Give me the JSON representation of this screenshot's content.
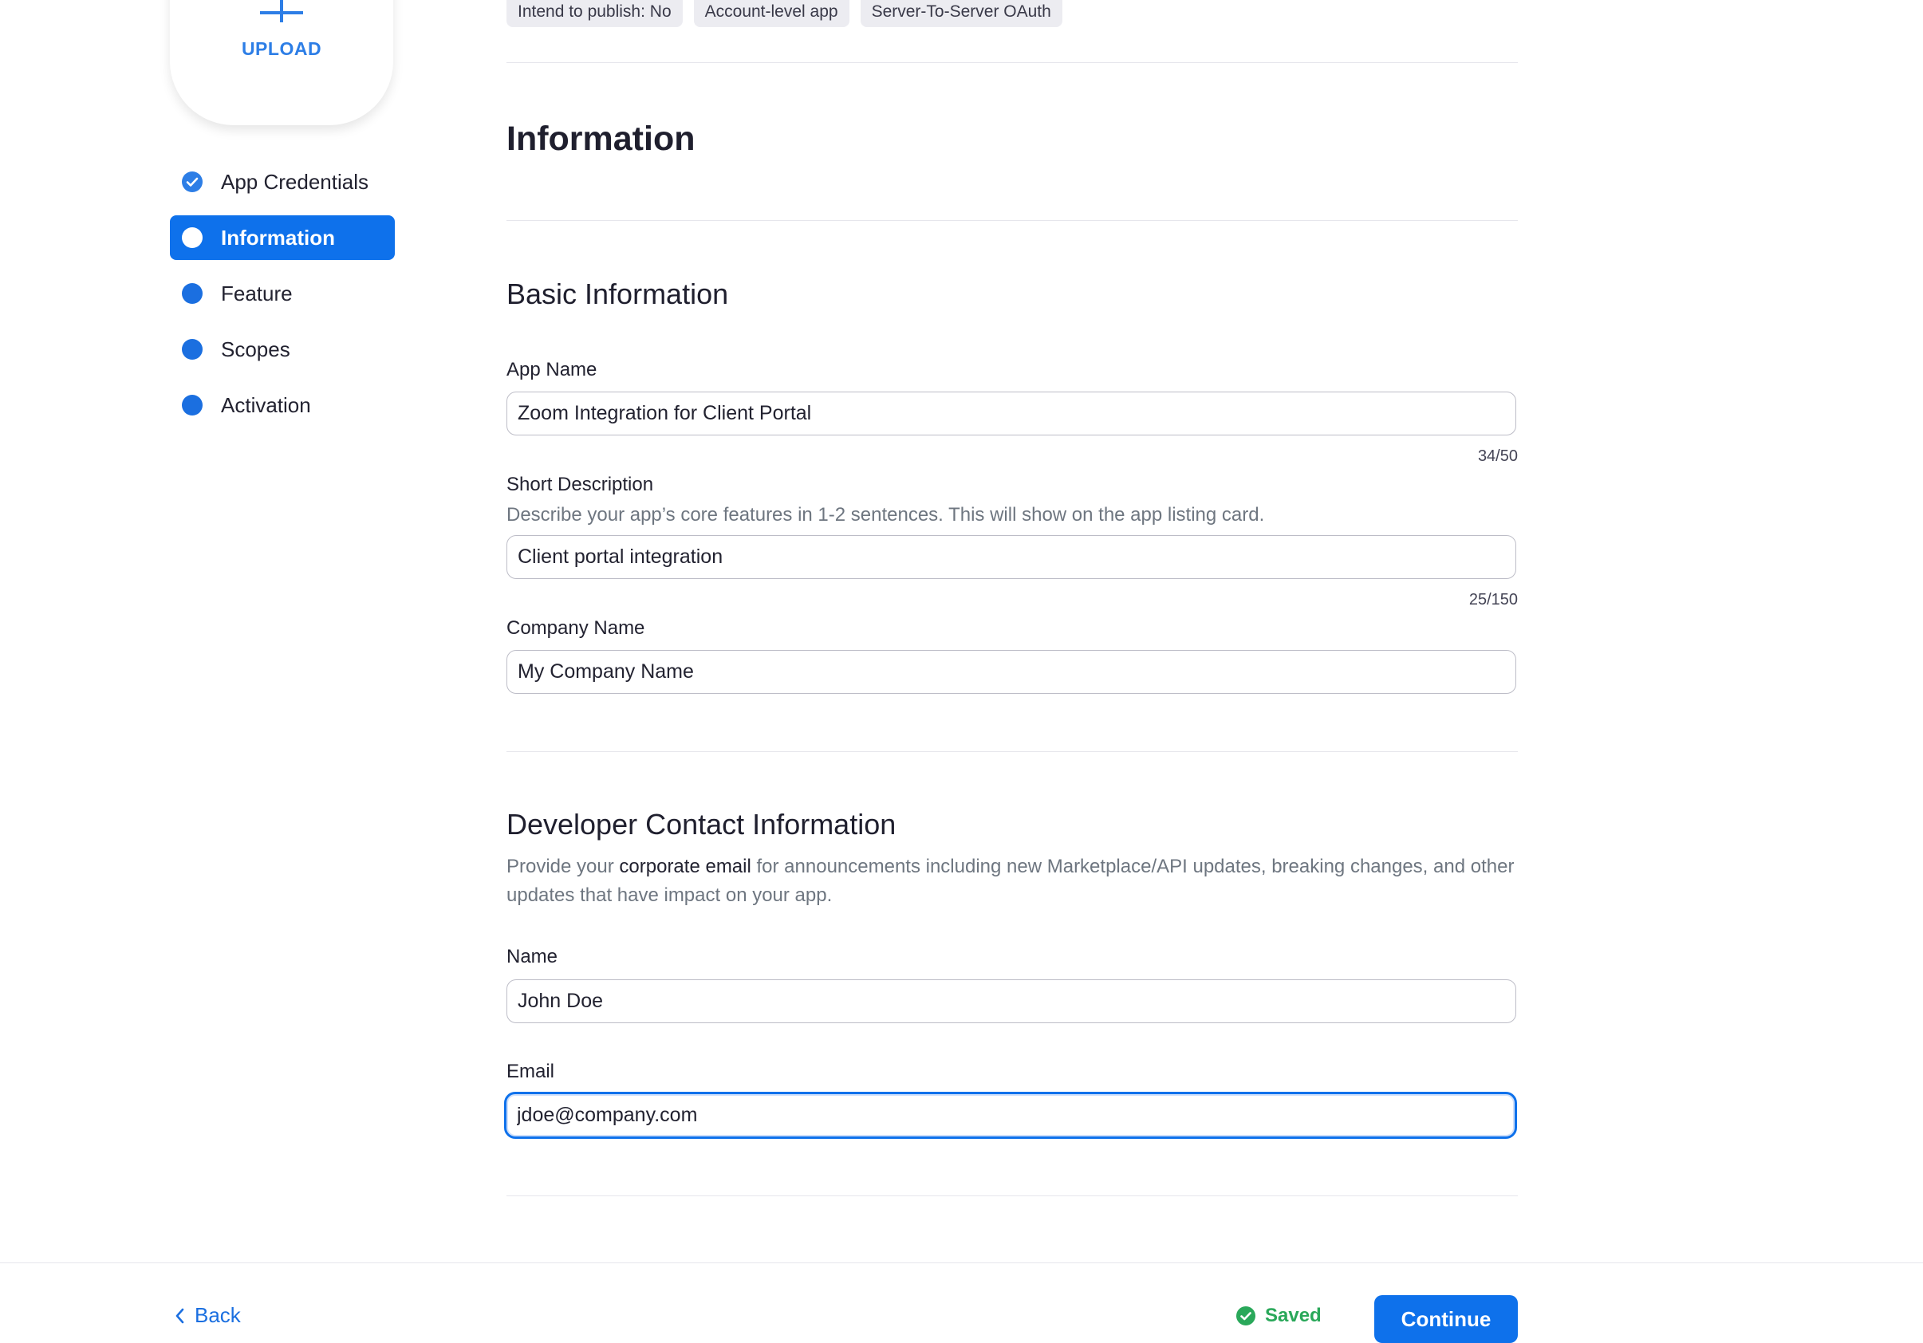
{
  "upload": {
    "label": "UPLOAD"
  },
  "sidebar": {
    "items": [
      {
        "label": "App Credentials",
        "state": "completed"
      },
      {
        "label": "Information",
        "state": "active"
      },
      {
        "label": "Feature",
        "state": "pending"
      },
      {
        "label": "Scopes",
        "state": "pending"
      },
      {
        "label": "Activation",
        "state": "pending"
      }
    ]
  },
  "tags": [
    "Intend to publish: No",
    "Account-level app",
    "Server-To-Server OAuth"
  ],
  "page": {
    "title": "Information"
  },
  "basic": {
    "heading": "Basic Information",
    "app_name": {
      "label": "App Name",
      "value": "Zoom Integration for Client Portal",
      "counter": "34/50"
    },
    "short_desc": {
      "label": "Short Description",
      "help": "Describe your app’s core features in 1-2 sentences. This will show on the app listing card.",
      "value": "Client portal integration",
      "counter": "25/150"
    },
    "company": {
      "label": "Company Name",
      "value": "My Company Name"
    }
  },
  "developer": {
    "heading": "Developer Contact Information",
    "help_before": "Provide your ",
    "help_strong": "corporate email",
    "help_after": " for announcements including new Marketplace/API updates, breaking changes, and other updates that have impact on your app.",
    "name": {
      "label": "Name",
      "value": "John Doe"
    },
    "email": {
      "label": "Email",
      "value": "jdoe@company.com"
    }
  },
  "footer": {
    "back_label": "Back",
    "saved_label": "Saved",
    "continue_label": "Continue"
  },
  "colors": {
    "accent": "#0e71eb",
    "success": "#2aa85a",
    "muted_text": "#6e7680"
  },
  "icons": {
    "upload": "plus-icon",
    "completed_step": "check-circle-icon",
    "back": "chevron-left-icon",
    "saved": "check-circle-icon"
  }
}
